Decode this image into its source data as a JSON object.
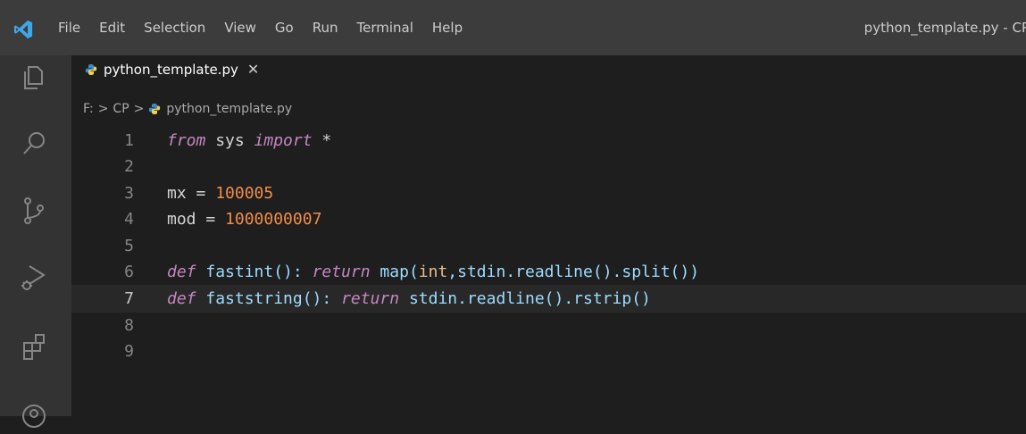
{
  "menu": [
    "File",
    "Edit",
    "Selection",
    "View",
    "Go",
    "Run",
    "Terminal",
    "Help"
  ],
  "window_title": "python_template.py - CP",
  "tab": {
    "label": "python_template.py",
    "close": "✕"
  },
  "breadcrumb": {
    "drive": "F:",
    "folder": "CP",
    "file": "python_template.py",
    "separator": ">"
  },
  "editor": {
    "current_line": 7,
    "lines": [
      {
        "n": "1",
        "tokens": [
          {
            "t": "from",
            "c": "kw"
          },
          {
            "t": " sys ",
            "c": "op"
          },
          {
            "t": "import",
            "c": "kw"
          },
          {
            "t": " *",
            "c": "op"
          }
        ]
      },
      {
        "n": "2",
        "tokens": []
      },
      {
        "n": "3",
        "tokens": [
          {
            "t": "mx",
            "c": "op"
          },
          {
            "t": " = ",
            "c": "op"
          },
          {
            "t": "100005",
            "c": "num"
          }
        ]
      },
      {
        "n": "4",
        "tokens": [
          {
            "t": "mod",
            "c": "op"
          },
          {
            "t": " = ",
            "c": "op"
          },
          {
            "t": "1000000007",
            "c": "num"
          }
        ]
      },
      {
        "n": "5",
        "tokens": []
      },
      {
        "n": "6",
        "tokens": [
          {
            "t": "def",
            "c": "def"
          },
          {
            "t": " fastint(): ",
            "c": "fn"
          },
          {
            "t": "return",
            "c": "kw"
          },
          {
            "t": " map(",
            "c": "fn"
          },
          {
            "t": "int",
            "c": "pu"
          },
          {
            "t": ",stdin.readline().split())",
            "c": "fn"
          }
        ]
      },
      {
        "n": "7",
        "tokens": [
          {
            "t": "def",
            "c": "def"
          },
          {
            "t": " faststring(): ",
            "c": "fn"
          },
          {
            "t": "return",
            "c": "kw"
          },
          {
            "t": " stdin.readline().rstrip()",
            "c": "fn"
          }
        ]
      },
      {
        "n": "8",
        "tokens": []
      },
      {
        "n": "9",
        "tokens": []
      }
    ]
  },
  "colors": {
    "titlebar": "#3c3c3c",
    "activitybar": "#333333",
    "editor_bg": "#1e1e1e",
    "keyword": "#c586c0",
    "number": "#f08d49",
    "vscode_blue": "#3ea7e8"
  },
  "icons": {
    "logo": "vscode-logo",
    "explorer": "files-icon",
    "search": "search-icon",
    "scm": "source-control-icon",
    "debug": "run-debug-icon",
    "extensions": "extensions-icon",
    "account": "account-icon",
    "python": "python-file-icon"
  }
}
